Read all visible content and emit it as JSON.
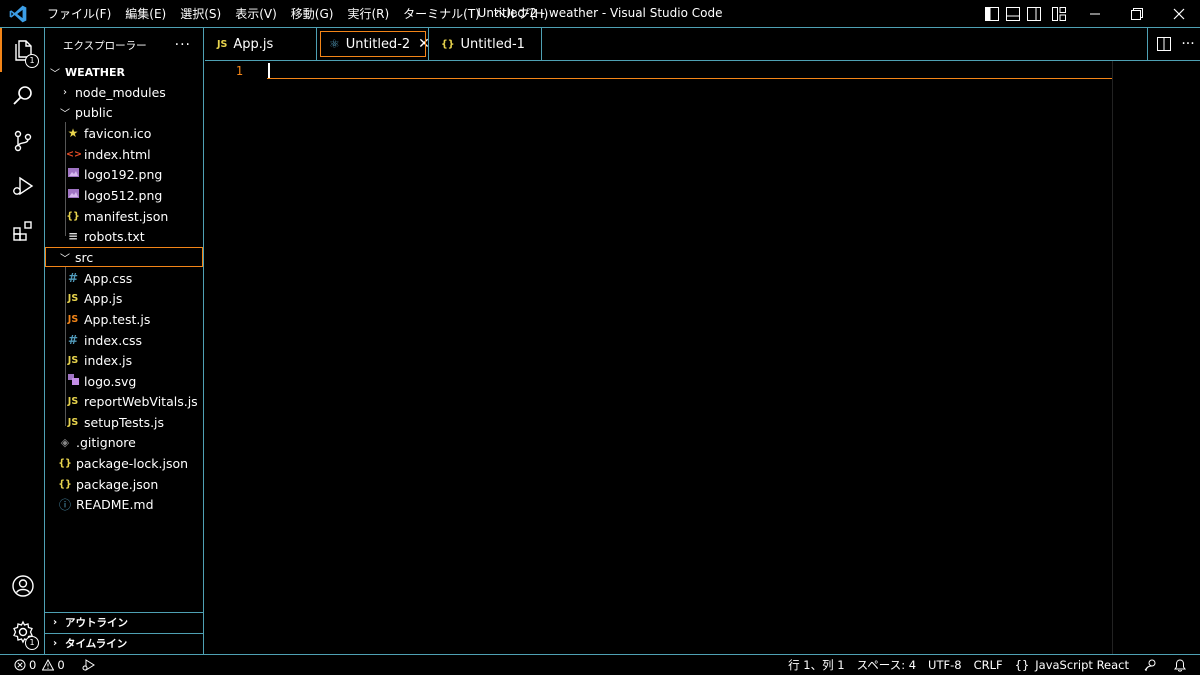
{
  "titlebar": {
    "menu": [
      "ファイル(F)",
      "編集(E)",
      "選択(S)",
      "表示(V)",
      "移動(G)",
      "実行(R)",
      "ターミナル(T)",
      "ヘルプ(H)"
    ],
    "window_title": "Untitled-2 - weather - Visual Studio Code"
  },
  "activitybar": {
    "explorer_badge": "1",
    "manage_badge": "1"
  },
  "sidebar": {
    "title": "エクスプローラー",
    "more": "···",
    "root": "WEATHER",
    "items": [
      {
        "label": "node_modules",
        "icon": "chevron-right"
      },
      {
        "label": "public",
        "icon": "chevron-down"
      },
      {
        "label": "favicon.ico",
        "icon": "★"
      },
      {
        "label": "index.html",
        "icon": "<>"
      },
      {
        "label": "logo192.png",
        "icon": "image"
      },
      {
        "label": "logo512.png",
        "icon": "image"
      },
      {
        "label": "manifest.json",
        "icon": "{}"
      },
      {
        "label": "robots.txt",
        "icon": "≡"
      },
      {
        "label": "src",
        "icon": "chevron-down"
      },
      {
        "label": "App.css",
        "icon": "#"
      },
      {
        "label": "App.js",
        "icon": "JS"
      },
      {
        "label": "App.test.js",
        "icon": "JS"
      },
      {
        "label": "index.css",
        "icon": "#"
      },
      {
        "label": "index.js",
        "icon": "JS"
      },
      {
        "label": "logo.svg",
        "icon": "svg"
      },
      {
        "label": "reportWebVitals.js",
        "icon": "JS"
      },
      {
        "label": "setupTests.js",
        "icon": "JS"
      },
      {
        "label": ".gitignore",
        "icon": "◈"
      },
      {
        "label": "package-lock.json",
        "icon": "{}"
      },
      {
        "label": "package.json",
        "icon": "{}"
      },
      {
        "label": "README.md",
        "icon": "ⓘ"
      }
    ],
    "outline": "アウトライン",
    "timeline": "タイムライン"
  },
  "tabs": [
    {
      "label": "App.js",
      "icon": "JS"
    },
    {
      "label": "Untitled-2",
      "icon": "⚛",
      "close": "✕"
    },
    {
      "label": "Untitled-1",
      "icon": "{}"
    }
  ],
  "editor": {
    "line_number": "1"
  },
  "statusbar": {
    "errors": "0",
    "warnings": "0",
    "position": "行 1、列 1",
    "spaces": "スペース: 4",
    "encoding": "UTF-8",
    "eol": "CRLF",
    "language_icon": "{}",
    "language": "JavaScript React"
  },
  "colors": {
    "accent": "#f38518",
    "border": "#4ea0b3",
    "js": "#e8d44d",
    "css": "#519aba",
    "html": "#e44d26",
    "json": "#e8d44d",
    "image": "#a074c4",
    "star": "#e8d44d"
  }
}
